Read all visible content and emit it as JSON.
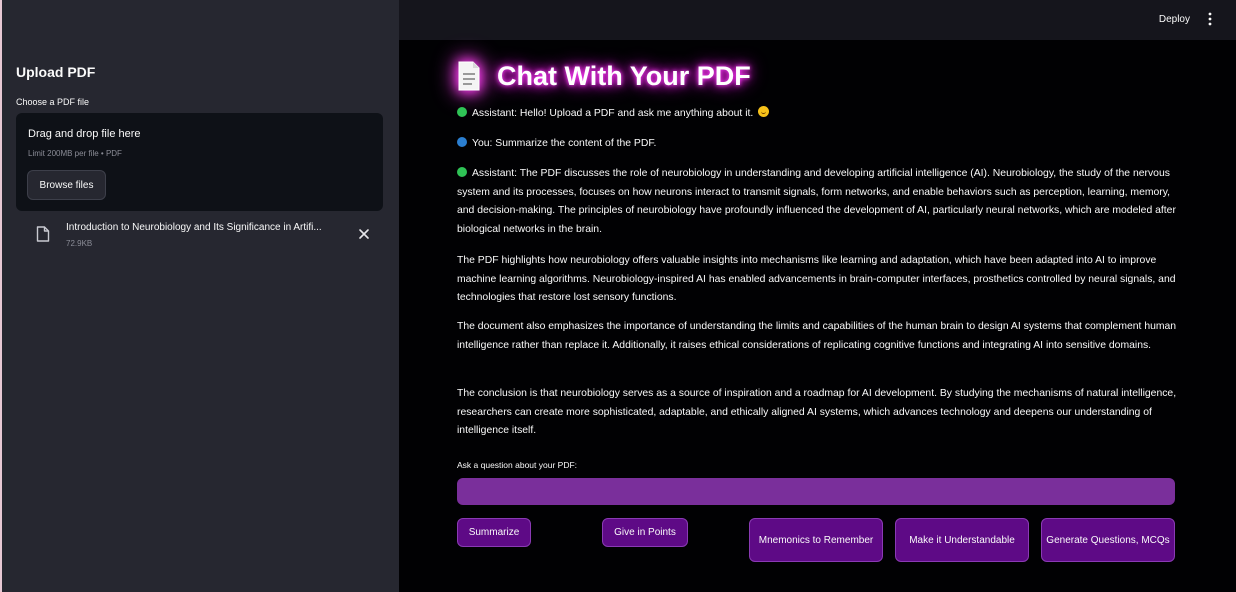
{
  "sidebar": {
    "title": "Upload PDF",
    "uploader_label": "Choose a PDF file",
    "dropzone_title": "Drag and drop file here",
    "dropzone_limit": "Limit 200MB per file • PDF",
    "browse_label": "Browse files",
    "file": {
      "name": "Introduction to Neurobiology and Its Significance in Artifi...",
      "size": "72.9KB"
    }
  },
  "header": {
    "deploy_label": "Deploy"
  },
  "main": {
    "title": "Chat With Your PDF",
    "messages": [
      {
        "role": "assistant",
        "dot_color": "#2fc356",
        "text": "Assistant: Hello! Upload a PDF and ask me anything about it."
      },
      {
        "role": "user",
        "dot_color": "#2b7fd1",
        "text": "You: Summarize the content of the PDF."
      },
      {
        "role": "assistant",
        "dot_color": "#2fc356",
        "text": "Assistant: The PDF discusses the role of neurobiology in understanding and developing artificial intelligence (AI). Neurobiology, the study of the nervous system and its processes, focuses on how neurons interact to transmit signals, form networks, and enable behaviors such as perception, learning, memory, and decision-making. The principles of neurobiology have profoundly influenced the development of AI, particularly neural networks, which are modeled after biological networks in the brain."
      }
    ],
    "paragraphs": [
      "The PDF highlights how neurobiology offers valuable insights into mechanisms like learning and adaptation, which have been adapted into AI to improve machine learning algorithms. Neurobiology-inspired AI has enabled advancements in brain-computer interfaces, prosthetics controlled by neural signals, and technologies that restore lost sensory functions.",
      "The document also emphasizes the importance of understanding the limits and capabilities of the human brain to design AI systems that complement human intelligence rather than replace it. Additionally, it raises ethical considerations of replicating cognitive functions and integrating AI into sensitive domains.",
      "The conclusion is that neurobiology serves as a source of inspiration and a roadmap for AI development. By studying the mechanisms of natural intelligence, researchers can create more sophisticated, adaptable, and ethically aligned AI systems, which advances technology and deepens our understanding of intelligence itself."
    ],
    "ask_label": "Ask a question about your PDF:",
    "ask_value": "",
    "buttons": [
      {
        "label": "Summarize"
      },
      {
        "label": "Give in Points"
      },
      {
        "label": "Mnemonics to Remember"
      },
      {
        "label": "Make it Understandable"
      },
      {
        "label": "Generate Questions, MCQs"
      }
    ]
  },
  "colors": {
    "accent": "#7a2f9b",
    "button_bg": "#5e0a86",
    "title_glow": "#ff2cf0",
    "sidebar_bg": "#262730"
  },
  "icons": {
    "file": "file-icon",
    "close": "close-icon",
    "menu": "kebab-menu-icon",
    "title": "page-facing-up-icon",
    "smile": "smiling-face-icon"
  }
}
